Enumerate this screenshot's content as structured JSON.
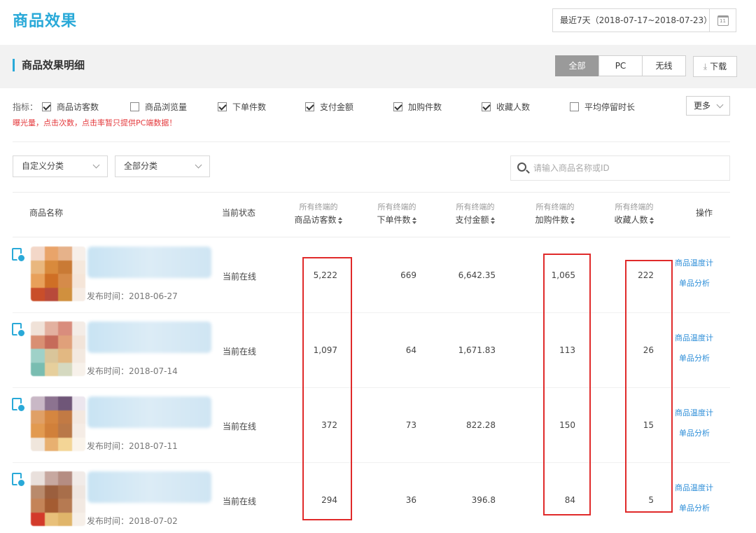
{
  "header": {
    "title": "商品效果",
    "date_range": "最近7天（2018-07-17~2018-07-23）",
    "calendar_glyph": "11"
  },
  "section": {
    "title": "商品效果明细",
    "tabs": [
      "全部",
      "PC",
      "无线"
    ],
    "active_tab": "全部",
    "download_label": "下载",
    "download_glyph": "⤓"
  },
  "metrics": {
    "prefix": "指标：",
    "items": [
      {
        "label": "商品访客数",
        "checked": true
      },
      {
        "label": "商品浏览量",
        "checked": false
      },
      {
        "label": "下单件数",
        "checked": true
      },
      {
        "label": "支付金额",
        "checked": true
      },
      {
        "label": "加购件数",
        "checked": true
      },
      {
        "label": "收藏人数",
        "checked": true
      },
      {
        "label": "平均停留时长",
        "checked": false
      }
    ],
    "more_label": "更多",
    "warning": "曝光量，点击次数，点击率暂只提供PC端数据！"
  },
  "filters": {
    "custom_category": "自定义分类",
    "all_category": "全部分类",
    "search_placeholder": "请输入商品名称或ID"
  },
  "table": {
    "headers": {
      "name": "商品名称",
      "status": "当前状态",
      "sub": "所有终端的",
      "visitors": "商品访客数",
      "orders": "下单件数",
      "payment": "支付金额",
      "cart": "加购件数",
      "favorites": "收藏人数",
      "actions": "操作"
    },
    "rows": [
      {
        "publish_time": "发布时间：2018-06-27",
        "status": "当前在线",
        "visitors": "5,222",
        "orders": "669",
        "payment": "6,642.35",
        "cart": "1,065",
        "favorites": "222",
        "op1": "商品温度计",
        "op2": "单品分析"
      },
      {
        "publish_time": "发布时间：2018-07-14",
        "status": "当前在线",
        "visitors": "1,097",
        "orders": "64",
        "payment": "1,671.83",
        "cart": "113",
        "favorites": "26",
        "op1": "商品温度计",
        "op2": "单品分析"
      },
      {
        "publish_time": "发布时间：2018-07-11",
        "status": "当前在线",
        "visitors": "372",
        "orders": "73",
        "payment": "822.28",
        "cart": "150",
        "favorites": "15",
        "op1": "商品温度计",
        "op2": "单品分析"
      },
      {
        "publish_time": "发布时间：2018-07-02",
        "status": "当前在线",
        "visitors": "294",
        "orders": "36",
        "payment": "396.8",
        "cart": "84",
        "favorites": "5",
        "op1": "商品温度计",
        "op2": "单品分析"
      }
    ]
  },
  "colors": {
    "accent": "#29a9d8",
    "link": "#2d8ed8",
    "highlight": "#e02a2a",
    "active_tab": "#9a9a9a"
  }
}
